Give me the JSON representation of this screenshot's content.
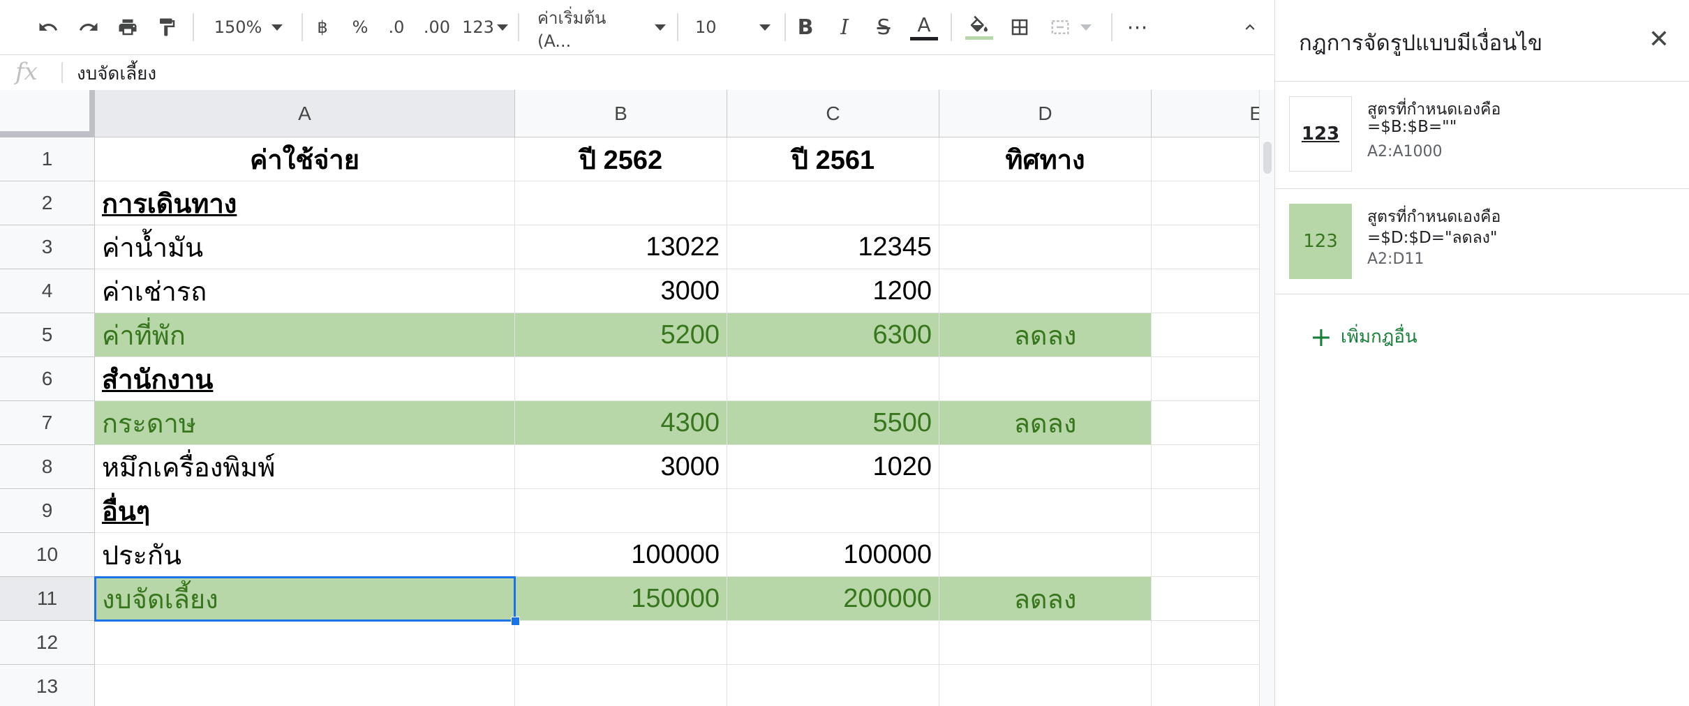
{
  "toolbar": {
    "zoom": "150%",
    "currency": "฿",
    "percent": "%",
    "decrease_decimal": ".0",
    "increase_decimal": ".00",
    "more_formats": "123",
    "font": "ค่าเริ่มต้น (A...",
    "font_size": "10",
    "bold": "B",
    "italic": "I",
    "strike": "S",
    "text_color": "A",
    "more": "⋯",
    "icons": [
      "undo-icon",
      "redo-icon",
      "print-icon",
      "paint-format-icon",
      "fill-color-icon",
      "borders-icon",
      "merge-cells-icon",
      "collapse-icon"
    ]
  },
  "formula_bar": {
    "fx": "fx",
    "content": "งบจัดเลี้ยง"
  },
  "grid": {
    "columns": [
      "A",
      "B",
      "C",
      "D",
      "E"
    ],
    "rows": [
      "1",
      "2",
      "3",
      "4",
      "5",
      "6",
      "7",
      "8",
      "9",
      "10",
      "11",
      "12",
      "13"
    ],
    "cells": [
      [
        "ค่าใช้จ่าย",
        "ปี 2562",
        "ปี 2561",
        "ทิศทาง"
      ],
      [
        "การเดินทาง",
        "",
        "",
        ""
      ],
      [
        "ค่าน้ำมัน",
        "13022",
        "12345",
        ""
      ],
      [
        "ค่าเช่ารถ",
        "3000",
        "1200",
        ""
      ],
      [
        "ค่าที่พัก",
        "5200",
        "6300",
        "ลดลง"
      ],
      [
        "สำนักงาน",
        "",
        "",
        ""
      ],
      [
        "กระดาษ",
        "4300",
        "5500",
        "ลดลง"
      ],
      [
        "หมึกเครื่องพิมพ์",
        "3000",
        "1020",
        ""
      ],
      [
        "อื่นๆ",
        "",
        "",
        ""
      ],
      [
        "ประกัน",
        "100000",
        "100000",
        ""
      ],
      [
        "งบจัดเลี้ยง",
        "150000",
        "200000",
        "ลดลง"
      ],
      [
        "",
        "",
        "",
        ""
      ],
      [
        "",
        "",
        "",
        ""
      ]
    ],
    "selected_cell": "A11",
    "highlight_color": "#b7d7a8",
    "highlight_text_color": "#38761d"
  },
  "panel": {
    "title": "กฎการจัดรูปแบบมีเงื่อนไข",
    "close_icon": "close-icon",
    "rules": [
      {
        "preview": "123",
        "line1": "สูตรที่กำหนดเองคือ",
        "line2": "=$B:$B=\"\"",
        "range": "A2:A1000"
      },
      {
        "preview": "123",
        "line1": "สูตรที่กำหนดเองคือ",
        "line2": "=$D:$D=\"ลดลง\"",
        "range": "A2:D11"
      }
    ],
    "add_rule": "เพิ่มกฎอื่น",
    "add_icon": "plus-icon"
  }
}
